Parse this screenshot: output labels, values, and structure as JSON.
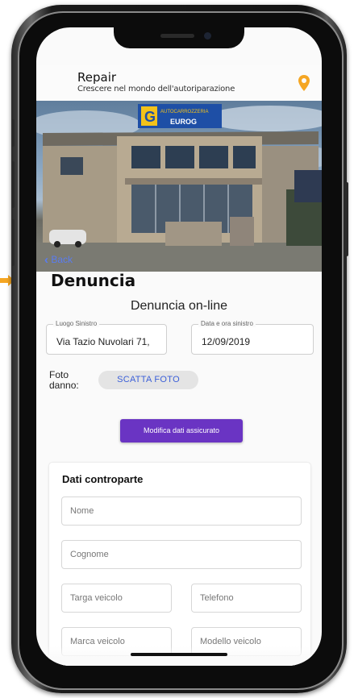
{
  "header": {
    "title": "Repair",
    "subtitle": "Crescere nel mondo dell'autoriparazione"
  },
  "banner": {
    "sign_line1": "AUTOCARROZZERIA",
    "sign_line2": "EUROG",
    "sign_letter": "G"
  },
  "nav": {
    "back_label": "Back"
  },
  "page": {
    "title": "Denuncia",
    "form_title": "Denuncia on-line"
  },
  "fields": {
    "place_label": "Luogo Sinistro",
    "place_value": "Via Tazio Nuvolari 71,",
    "date_label": "Data e ora sinistro",
    "date_value": "12/09/2019"
  },
  "photo": {
    "label": "Foto danno:",
    "button": "SCATTA FOTO"
  },
  "actions": {
    "edit_insured": "Modifica dati assicurato"
  },
  "counterparty": {
    "title": "Dati controparte",
    "name_placeholder": "Nome",
    "surname_placeholder": "Cognome",
    "plate_placeholder": "Targa veicolo",
    "phone_placeholder": "Telefono",
    "brand_placeholder": "Marca veicolo",
    "model_placeholder": "Modello veicolo"
  },
  "colors": {
    "accent": "#6a34c3",
    "link": "#5a7cf0",
    "pin": "#f5a623"
  }
}
